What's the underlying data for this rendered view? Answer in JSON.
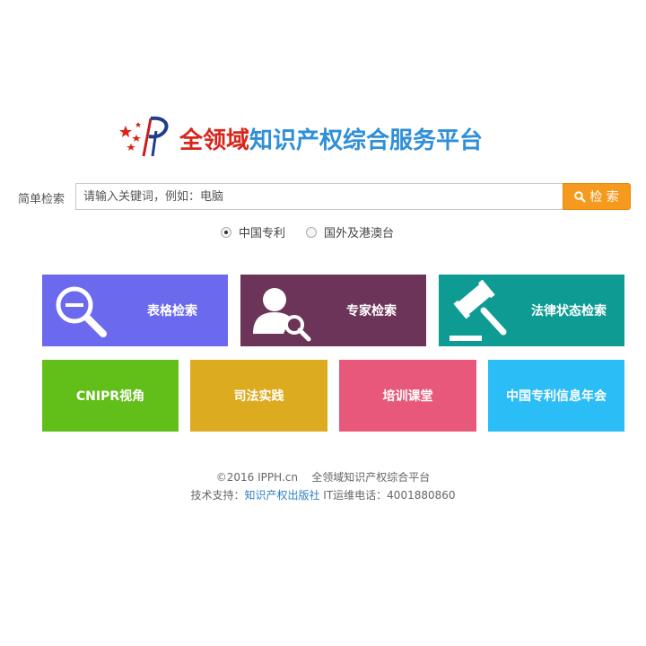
{
  "logo": {
    "part1": "全领域",
    "part2": "知识产权综合服务平台"
  },
  "search": {
    "label": "简单检索",
    "placeholder": "请输入关键词，例如：电脑",
    "button": "检 索"
  },
  "scope": {
    "options": [
      {
        "label": "中国专利",
        "selected": true
      },
      {
        "label": "国外及港澳台",
        "selected": false
      }
    ]
  },
  "tiles_row1": [
    {
      "label": "表格检索",
      "color": "#6b69ee",
      "icon": "magnifier-icon"
    },
    {
      "label": "专家检索",
      "color": "#6b3458",
      "icon": "user-search-icon"
    },
    {
      "label": "法律状态检索",
      "color": "#0e9b93",
      "icon": "gavel-icon"
    }
  ],
  "tiles_row2": [
    {
      "label": "CNIPR视角",
      "color": "#62bf1a"
    },
    {
      "label": "司法实践",
      "color": "#dcab1f"
    },
    {
      "label": "培训课堂",
      "color": "#e8587a"
    },
    {
      "label": "中国专利信息年会",
      "color": "#2bbdf6"
    }
  ],
  "footer": {
    "copyright": "©2016 IPPH.cn    全领域知识产权综合平台",
    "support_prefix": "技术支持：",
    "support_link": "知识产权出版社",
    "support_suffix": " IT运维电话：4001880860"
  }
}
